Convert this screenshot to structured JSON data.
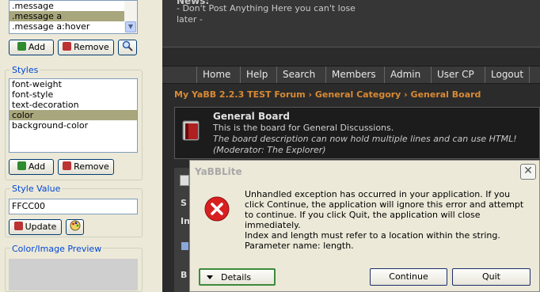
{
  "classes_list": {
    "items": [
      ".message",
      ".message a",
      ".message a:hover"
    ],
    "selected": 1
  },
  "class_buttons": {
    "add": "Add",
    "remove": "Remove"
  },
  "styles": {
    "label": "Styles",
    "items": [
      "font-weight",
      "font-style",
      "text-decoration",
      "color",
      "background-color"
    ],
    "selected": 3,
    "add": "Add",
    "remove": "Remove"
  },
  "style_value": {
    "label": "Style Value",
    "value": "FFCC00",
    "update": "Update"
  },
  "preview": {
    "label": "Color/Image Preview"
  },
  "forum": {
    "news_title": "News:",
    "news_text": "- Don't Post Anything Here you can't lose later -",
    "nav": [
      "Home",
      "Help",
      "Search",
      "Members",
      "Admin",
      "User CP",
      "Logout"
    ],
    "breadcrumb": "My YaBB 2.2.3 TEST Forum › General Category › General Board",
    "board": {
      "name": "General Board",
      "description": "This is the board for General Discussions.",
      "description2": "The board description can now hold multiple lines and can use HTML!",
      "moderator": "(Moderator: The Explorer)"
    },
    "table_rows": [
      "S",
      "In",
      "B"
    ]
  },
  "dialog": {
    "title": "YaBBLite",
    "message1": "Unhandled exception has occurred in your application. If you click Continue, the application will ignore this error and attempt to continue. If you click Quit, the application will close immediately.",
    "message2": "Index and length must refer to a location within the string.",
    "message3": "Parameter name: length.",
    "details": "Details",
    "continue": "Continue",
    "quit": "Quit"
  },
  "colors": {
    "selection": "#a8a67d",
    "accent": "#d88a34",
    "forum_bg": "#2b2b2b"
  }
}
